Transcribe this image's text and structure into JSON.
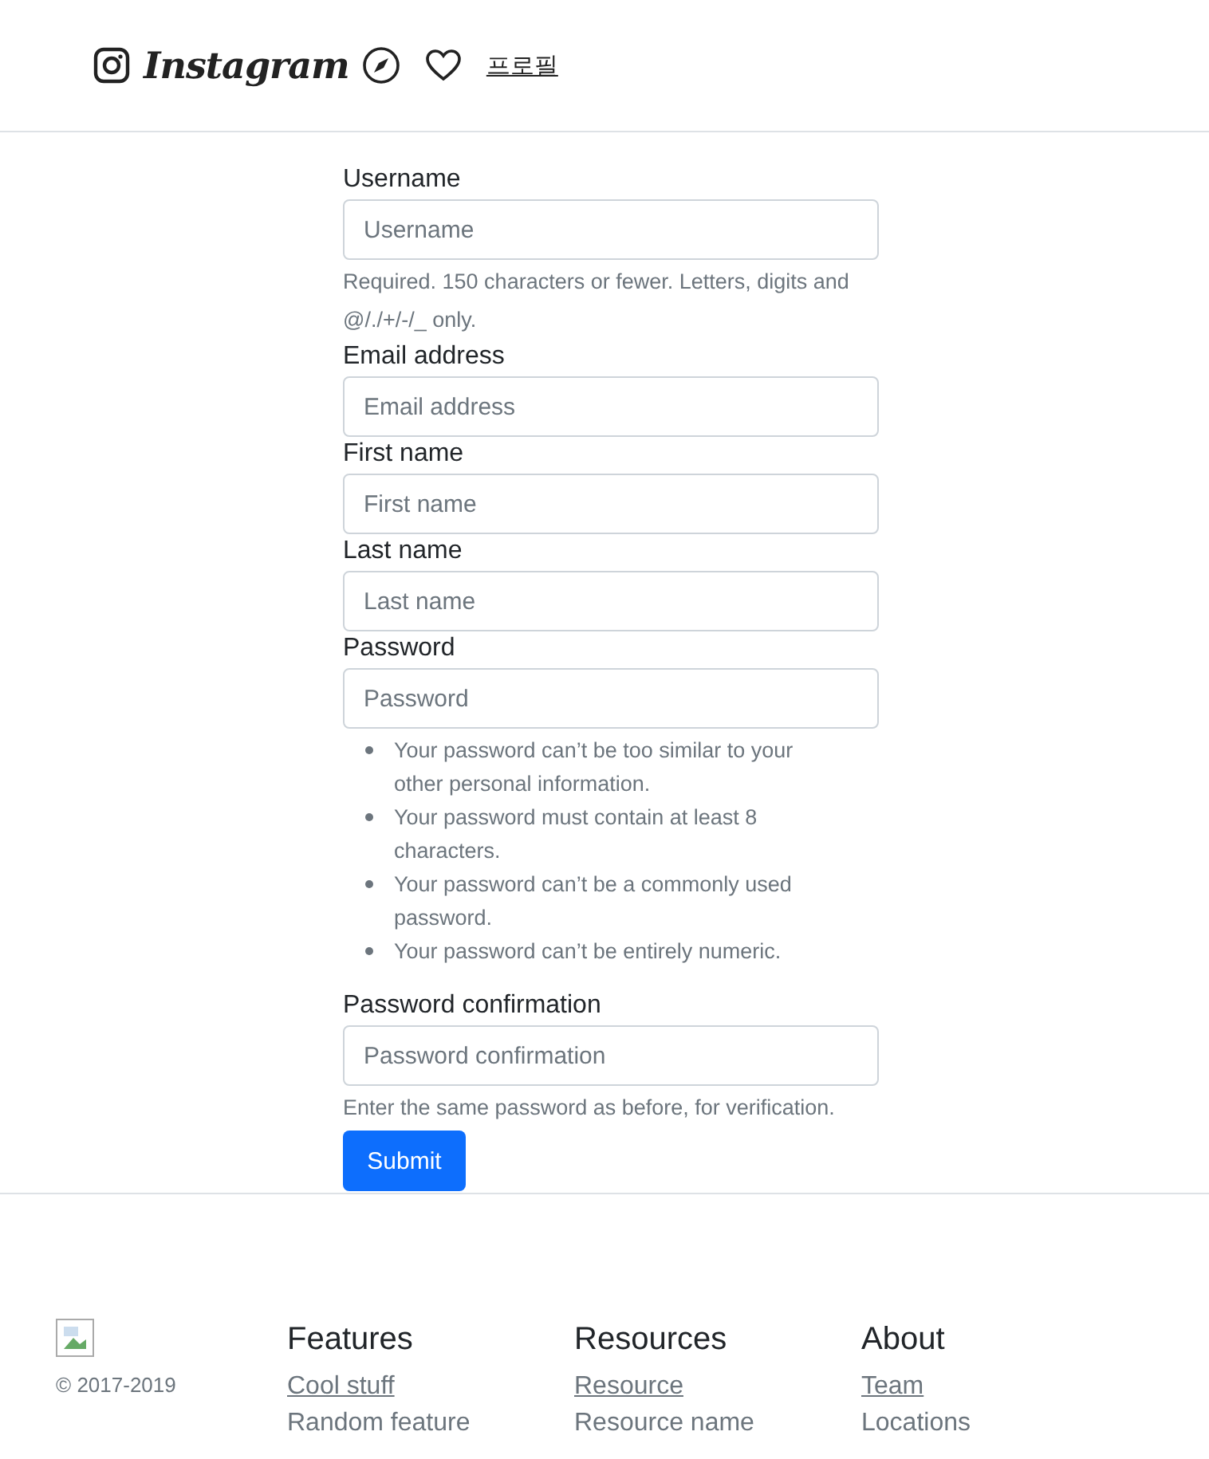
{
  "navbar": {
    "brand": "Instagram",
    "profile_link": "프로필"
  },
  "form": {
    "fields": [
      {
        "label": "Username",
        "placeholder": "Username",
        "help": "Required. 150 characters or fewer. Letters, digits and @/./+/-/_ only."
      },
      {
        "label": "Email address",
        "placeholder": "Email address"
      },
      {
        "label": "First name",
        "placeholder": "First name"
      },
      {
        "label": "Last name",
        "placeholder": "Last name"
      },
      {
        "label": "Password",
        "placeholder": "Password",
        "rules": [
          "Your password can’t be too similar to your other personal information.",
          "Your password must contain at least 8 characters.",
          "Your password can’t be a commonly used password.",
          "Your password can’t be entirely numeric."
        ]
      },
      {
        "label": "Password confirmation",
        "placeholder": "Password confirmation",
        "help": "Enter the same password as before, for verification."
      }
    ],
    "submit": "Submit"
  },
  "footer": {
    "copyright": "© 2017-2019",
    "columns": [
      {
        "title": "Features",
        "links": [
          "Cool stuff",
          "Random feature"
        ]
      },
      {
        "title": "Resources",
        "links": [
          "Resource",
          "Resource name"
        ]
      },
      {
        "title": "About",
        "links": [
          "Team",
          "Locations"
        ]
      }
    ]
  }
}
